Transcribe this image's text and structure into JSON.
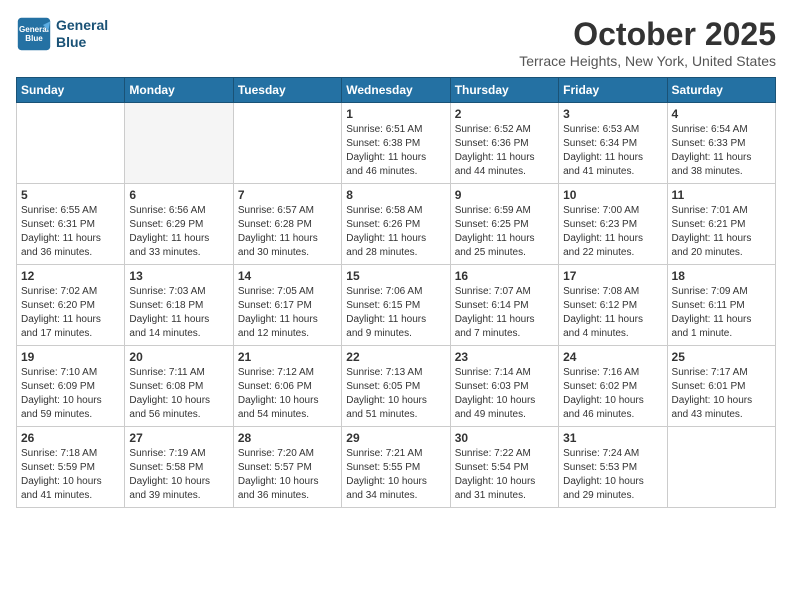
{
  "header": {
    "logo_line1": "General",
    "logo_line2": "Blue",
    "month_title": "October 2025",
    "location": "Terrace Heights, New York, United States"
  },
  "weekdays": [
    "Sunday",
    "Monday",
    "Tuesday",
    "Wednesday",
    "Thursday",
    "Friday",
    "Saturday"
  ],
  "weeks": [
    [
      {
        "day": "",
        "info": ""
      },
      {
        "day": "",
        "info": ""
      },
      {
        "day": "",
        "info": ""
      },
      {
        "day": "1",
        "info": "Sunrise: 6:51 AM\nSunset: 6:38 PM\nDaylight: 11 hours\nand 46 minutes."
      },
      {
        "day": "2",
        "info": "Sunrise: 6:52 AM\nSunset: 6:36 PM\nDaylight: 11 hours\nand 44 minutes."
      },
      {
        "day": "3",
        "info": "Sunrise: 6:53 AM\nSunset: 6:34 PM\nDaylight: 11 hours\nand 41 minutes."
      },
      {
        "day": "4",
        "info": "Sunrise: 6:54 AM\nSunset: 6:33 PM\nDaylight: 11 hours\nand 38 minutes."
      }
    ],
    [
      {
        "day": "5",
        "info": "Sunrise: 6:55 AM\nSunset: 6:31 PM\nDaylight: 11 hours\nand 36 minutes."
      },
      {
        "day": "6",
        "info": "Sunrise: 6:56 AM\nSunset: 6:29 PM\nDaylight: 11 hours\nand 33 minutes."
      },
      {
        "day": "7",
        "info": "Sunrise: 6:57 AM\nSunset: 6:28 PM\nDaylight: 11 hours\nand 30 minutes."
      },
      {
        "day": "8",
        "info": "Sunrise: 6:58 AM\nSunset: 6:26 PM\nDaylight: 11 hours\nand 28 minutes."
      },
      {
        "day": "9",
        "info": "Sunrise: 6:59 AM\nSunset: 6:25 PM\nDaylight: 11 hours\nand 25 minutes."
      },
      {
        "day": "10",
        "info": "Sunrise: 7:00 AM\nSunset: 6:23 PM\nDaylight: 11 hours\nand 22 minutes."
      },
      {
        "day": "11",
        "info": "Sunrise: 7:01 AM\nSunset: 6:21 PM\nDaylight: 11 hours\nand 20 minutes."
      }
    ],
    [
      {
        "day": "12",
        "info": "Sunrise: 7:02 AM\nSunset: 6:20 PM\nDaylight: 11 hours\nand 17 minutes."
      },
      {
        "day": "13",
        "info": "Sunrise: 7:03 AM\nSunset: 6:18 PM\nDaylight: 11 hours\nand 14 minutes."
      },
      {
        "day": "14",
        "info": "Sunrise: 7:05 AM\nSunset: 6:17 PM\nDaylight: 11 hours\nand 12 minutes."
      },
      {
        "day": "15",
        "info": "Sunrise: 7:06 AM\nSunset: 6:15 PM\nDaylight: 11 hours\nand 9 minutes."
      },
      {
        "day": "16",
        "info": "Sunrise: 7:07 AM\nSunset: 6:14 PM\nDaylight: 11 hours\nand 7 minutes."
      },
      {
        "day": "17",
        "info": "Sunrise: 7:08 AM\nSunset: 6:12 PM\nDaylight: 11 hours\nand 4 minutes."
      },
      {
        "day": "18",
        "info": "Sunrise: 7:09 AM\nSunset: 6:11 PM\nDaylight: 11 hours\nand 1 minute."
      }
    ],
    [
      {
        "day": "19",
        "info": "Sunrise: 7:10 AM\nSunset: 6:09 PM\nDaylight: 10 hours\nand 59 minutes."
      },
      {
        "day": "20",
        "info": "Sunrise: 7:11 AM\nSunset: 6:08 PM\nDaylight: 10 hours\nand 56 minutes."
      },
      {
        "day": "21",
        "info": "Sunrise: 7:12 AM\nSunset: 6:06 PM\nDaylight: 10 hours\nand 54 minutes."
      },
      {
        "day": "22",
        "info": "Sunrise: 7:13 AM\nSunset: 6:05 PM\nDaylight: 10 hours\nand 51 minutes."
      },
      {
        "day": "23",
        "info": "Sunrise: 7:14 AM\nSunset: 6:03 PM\nDaylight: 10 hours\nand 49 minutes."
      },
      {
        "day": "24",
        "info": "Sunrise: 7:16 AM\nSunset: 6:02 PM\nDaylight: 10 hours\nand 46 minutes."
      },
      {
        "day": "25",
        "info": "Sunrise: 7:17 AM\nSunset: 6:01 PM\nDaylight: 10 hours\nand 43 minutes."
      }
    ],
    [
      {
        "day": "26",
        "info": "Sunrise: 7:18 AM\nSunset: 5:59 PM\nDaylight: 10 hours\nand 41 minutes."
      },
      {
        "day": "27",
        "info": "Sunrise: 7:19 AM\nSunset: 5:58 PM\nDaylight: 10 hours\nand 39 minutes."
      },
      {
        "day": "28",
        "info": "Sunrise: 7:20 AM\nSunset: 5:57 PM\nDaylight: 10 hours\nand 36 minutes."
      },
      {
        "day": "29",
        "info": "Sunrise: 7:21 AM\nSunset: 5:55 PM\nDaylight: 10 hours\nand 34 minutes."
      },
      {
        "day": "30",
        "info": "Sunrise: 7:22 AM\nSunset: 5:54 PM\nDaylight: 10 hours\nand 31 minutes."
      },
      {
        "day": "31",
        "info": "Sunrise: 7:24 AM\nSunset: 5:53 PM\nDaylight: 10 hours\nand 29 minutes."
      },
      {
        "day": "",
        "info": ""
      }
    ]
  ]
}
